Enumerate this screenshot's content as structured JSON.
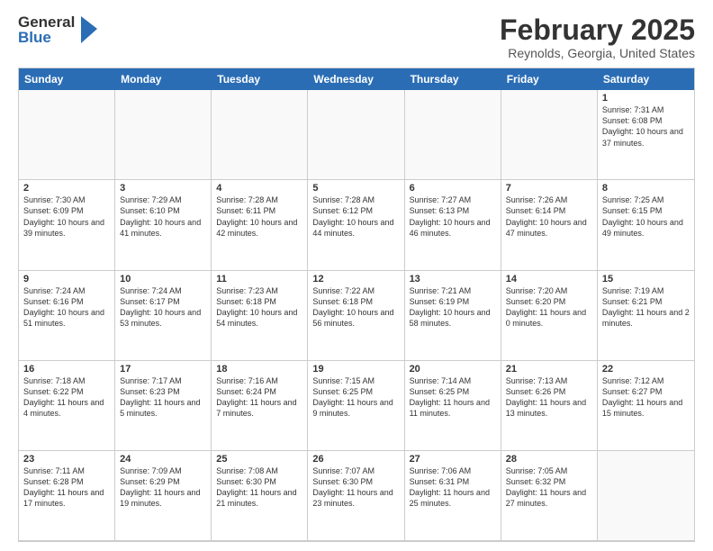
{
  "header": {
    "logo_general": "General",
    "logo_blue": "Blue",
    "month_year": "February 2025",
    "location": "Reynolds, Georgia, United States"
  },
  "day_headers": [
    "Sunday",
    "Monday",
    "Tuesday",
    "Wednesday",
    "Thursday",
    "Friday",
    "Saturday"
  ],
  "cells": [
    {
      "date": "",
      "info": "",
      "empty": true
    },
    {
      "date": "",
      "info": "",
      "empty": true
    },
    {
      "date": "",
      "info": "",
      "empty": true
    },
    {
      "date": "",
      "info": "",
      "empty": true
    },
    {
      "date": "",
      "info": "",
      "empty": true
    },
    {
      "date": "",
      "info": "",
      "empty": true
    },
    {
      "date": "1",
      "info": "Sunrise: 7:31 AM\nSunset: 6:08 PM\nDaylight: 10 hours\nand 37 minutes."
    },
    {
      "date": "2",
      "info": "Sunrise: 7:30 AM\nSunset: 6:09 PM\nDaylight: 10 hours\nand 39 minutes."
    },
    {
      "date": "3",
      "info": "Sunrise: 7:29 AM\nSunset: 6:10 PM\nDaylight: 10 hours\nand 41 minutes."
    },
    {
      "date": "4",
      "info": "Sunrise: 7:28 AM\nSunset: 6:11 PM\nDaylight: 10 hours\nand 42 minutes."
    },
    {
      "date": "5",
      "info": "Sunrise: 7:28 AM\nSunset: 6:12 PM\nDaylight: 10 hours\nand 44 minutes."
    },
    {
      "date": "6",
      "info": "Sunrise: 7:27 AM\nSunset: 6:13 PM\nDaylight: 10 hours\nand 46 minutes."
    },
    {
      "date": "7",
      "info": "Sunrise: 7:26 AM\nSunset: 6:14 PM\nDaylight: 10 hours\nand 47 minutes."
    },
    {
      "date": "8",
      "info": "Sunrise: 7:25 AM\nSunset: 6:15 PM\nDaylight: 10 hours\nand 49 minutes."
    },
    {
      "date": "9",
      "info": "Sunrise: 7:24 AM\nSunset: 6:16 PM\nDaylight: 10 hours\nand 51 minutes."
    },
    {
      "date": "10",
      "info": "Sunrise: 7:24 AM\nSunset: 6:17 PM\nDaylight: 10 hours\nand 53 minutes."
    },
    {
      "date": "11",
      "info": "Sunrise: 7:23 AM\nSunset: 6:18 PM\nDaylight: 10 hours\nand 54 minutes."
    },
    {
      "date": "12",
      "info": "Sunrise: 7:22 AM\nSunset: 6:18 PM\nDaylight: 10 hours\nand 56 minutes."
    },
    {
      "date": "13",
      "info": "Sunrise: 7:21 AM\nSunset: 6:19 PM\nDaylight: 10 hours\nand 58 minutes."
    },
    {
      "date": "14",
      "info": "Sunrise: 7:20 AM\nSunset: 6:20 PM\nDaylight: 11 hours\nand 0 minutes."
    },
    {
      "date": "15",
      "info": "Sunrise: 7:19 AM\nSunset: 6:21 PM\nDaylight: 11 hours\nand 2 minutes."
    },
    {
      "date": "16",
      "info": "Sunrise: 7:18 AM\nSunset: 6:22 PM\nDaylight: 11 hours\nand 4 minutes."
    },
    {
      "date": "17",
      "info": "Sunrise: 7:17 AM\nSunset: 6:23 PM\nDaylight: 11 hours\nand 5 minutes."
    },
    {
      "date": "18",
      "info": "Sunrise: 7:16 AM\nSunset: 6:24 PM\nDaylight: 11 hours\nand 7 minutes."
    },
    {
      "date": "19",
      "info": "Sunrise: 7:15 AM\nSunset: 6:25 PM\nDaylight: 11 hours\nand 9 minutes."
    },
    {
      "date": "20",
      "info": "Sunrise: 7:14 AM\nSunset: 6:25 PM\nDaylight: 11 hours\nand 11 minutes."
    },
    {
      "date": "21",
      "info": "Sunrise: 7:13 AM\nSunset: 6:26 PM\nDaylight: 11 hours\nand 13 minutes."
    },
    {
      "date": "22",
      "info": "Sunrise: 7:12 AM\nSunset: 6:27 PM\nDaylight: 11 hours\nand 15 minutes."
    },
    {
      "date": "23",
      "info": "Sunrise: 7:11 AM\nSunset: 6:28 PM\nDaylight: 11 hours\nand 17 minutes."
    },
    {
      "date": "24",
      "info": "Sunrise: 7:09 AM\nSunset: 6:29 PM\nDaylight: 11 hours\nand 19 minutes."
    },
    {
      "date": "25",
      "info": "Sunrise: 7:08 AM\nSunset: 6:30 PM\nDaylight: 11 hours\nand 21 minutes."
    },
    {
      "date": "26",
      "info": "Sunrise: 7:07 AM\nSunset: 6:30 PM\nDaylight: 11 hours\nand 23 minutes."
    },
    {
      "date": "27",
      "info": "Sunrise: 7:06 AM\nSunset: 6:31 PM\nDaylight: 11 hours\nand 25 minutes."
    },
    {
      "date": "28",
      "info": "Sunrise: 7:05 AM\nSunset: 6:32 PM\nDaylight: 11 hours\nand 27 minutes."
    },
    {
      "date": "",
      "info": "",
      "empty": true
    }
  ]
}
